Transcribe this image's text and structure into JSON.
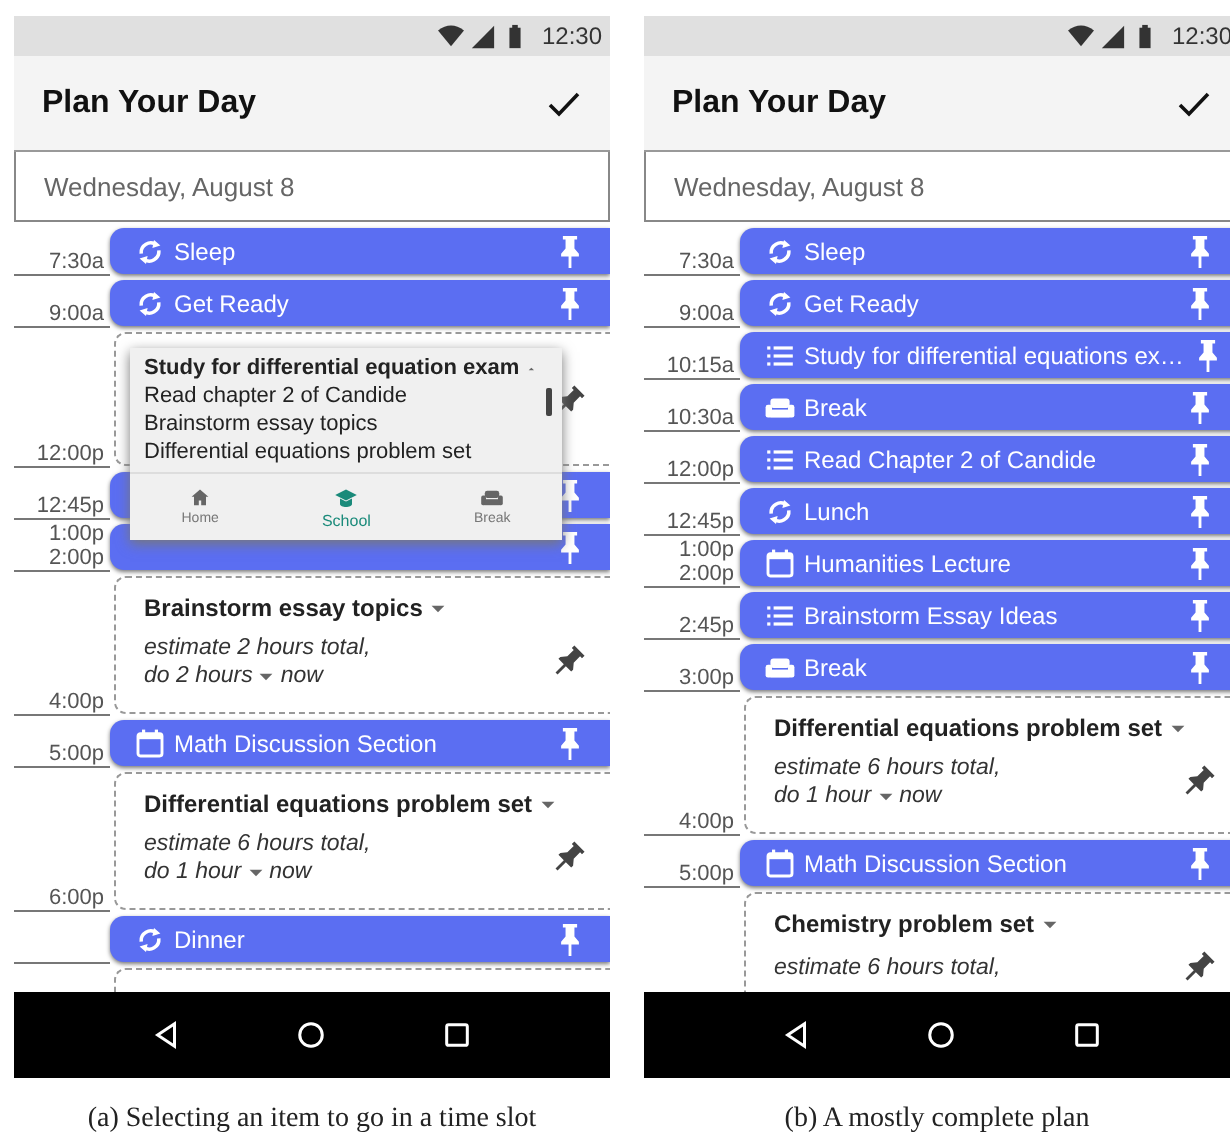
{
  "phones": [
    {
      "status_time": "12:30",
      "title": "Plan Your Day",
      "date": "Wednesday, August 8",
      "caption": "(a) Selecting an item to go in a time slot",
      "slots": [
        {
          "kind": "routine",
          "label": "Sleep",
          "times": [
            "7:30a"
          ],
          "pinned": true
        },
        {
          "kind": "routine",
          "label": "Get Ready",
          "times": [
            "9:00a"
          ],
          "pinned": true
        },
        {
          "kind": "open",
          "times": [
            "12:00p"
          ],
          "pinned": false
        },
        {
          "kind": "block",
          "times": [
            "12:45p"
          ],
          "pinned": true
        },
        {
          "kind": "block",
          "times": [
            "1:00p",
            "2:00p"
          ],
          "pinned": true
        },
        {
          "kind": "task",
          "title": "Brainstorm essay topics",
          "estimate": "estimate 2 hours total,",
          "amount": "do 2 hours",
          "when": "now",
          "times": [
            "4:00p"
          ],
          "pinned": false
        },
        {
          "kind": "class",
          "label": "Math Discussion Section",
          "times": [
            "5:00p"
          ],
          "pinned": true
        },
        {
          "kind": "task",
          "title": "Differential equations problem set",
          "estimate": "estimate 6 hours total,",
          "amount": "do 1 hour",
          "when": "now",
          "times": [
            "6:00p"
          ],
          "pinned": false
        },
        {
          "kind": "routine",
          "label": "Dinner",
          "pinned": true
        },
        {
          "kind": "open"
        }
      ],
      "popup": {
        "items": [
          {
            "kind": "group",
            "label": "Study for differential equation exam"
          },
          {
            "kind": "item",
            "label": "Read chapter 2 of Candide"
          },
          {
            "kind": "item",
            "label": "Brainstorm essay topics"
          },
          {
            "kind": "item",
            "label": "Differential equations problem set"
          }
        ],
        "tabs": [
          {
            "kind": "home",
            "label": "Home",
            "selected": false
          },
          {
            "kind": "school",
            "label": "School",
            "selected": true
          },
          {
            "kind": "break",
            "label": "Break",
            "selected": false
          }
        ]
      }
    },
    {
      "status_time": "12:30",
      "title": "Plan Your Day",
      "date": "Wednesday, August 8",
      "caption": "(b) A mostly complete plan",
      "slots": [
        {
          "kind": "routine",
          "label": "Sleep",
          "times": [
            "7:30a"
          ],
          "pinned": true
        },
        {
          "kind": "routine",
          "label": "Get Ready",
          "times": [
            "9:00a"
          ],
          "pinned": true
        },
        {
          "kind": "todo",
          "label": "Study for differential equations ex…",
          "times": [
            "10:15a"
          ],
          "pinned": true
        },
        {
          "kind": "break",
          "label": "Break",
          "times": [
            "10:30a"
          ],
          "pinned": true
        },
        {
          "kind": "todo",
          "label": "Read Chapter 2 of Candide",
          "times": [
            "12:00p"
          ],
          "pinned": true
        },
        {
          "kind": "routine",
          "label": "Lunch",
          "times": [
            "12:45p"
          ],
          "pinned": true
        },
        {
          "kind": "class",
          "label": "Humanities Lecture",
          "times": [
            "1:00p",
            "2:00p"
          ],
          "pinned": true
        },
        {
          "kind": "todo",
          "label": "Brainstorm Essay Ideas",
          "times": [
            "2:45p"
          ],
          "pinned": true
        },
        {
          "kind": "break",
          "label": "Break",
          "times": [
            "3:00p"
          ],
          "pinned": true
        },
        {
          "kind": "task",
          "title": "Differential equations problem set",
          "estimate": "estimate 6 hours total,",
          "amount": "do 1 hour",
          "when": "now",
          "times": [
            "4:00p"
          ],
          "pinned": false
        },
        {
          "kind": "class",
          "label": "Math Discussion Section",
          "times": [
            "5:00p"
          ],
          "pinned": true
        },
        {
          "kind": "task",
          "title": "Chemistry problem set",
          "estimate": "estimate 6 hours total,",
          "pinned": false
        }
      ]
    }
  ]
}
